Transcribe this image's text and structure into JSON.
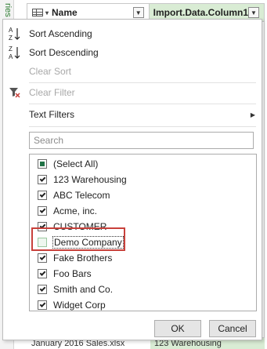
{
  "sidebar_label": "ries",
  "grid": {
    "col_name": "Name",
    "col_import": "Import.Data.Column1",
    "bottom_row": {
      "name": "January 2016 Sales.xlsx",
      "value": "123 Warehousing"
    }
  },
  "menu": {
    "sort_ascending": "Sort Ascending",
    "sort_descending": "Sort Descending",
    "clear_sort": "Clear Sort",
    "clear_filter": "Clear Filter",
    "text_filters": "Text Filters",
    "search_placeholder": "Search",
    "items": [
      {
        "label": "(Select All)",
        "state": "partial"
      },
      {
        "label": "123 Warehousing",
        "state": "checked"
      },
      {
        "label": "ABC Telecom",
        "state": "checked"
      },
      {
        "label": "Acme, inc.",
        "state": "checked"
      },
      {
        "label": "CUSTOMER",
        "state": "checked"
      },
      {
        "label": "Demo Company",
        "state": "unchecked"
      },
      {
        "label": "Fake Brothers",
        "state": "checked"
      },
      {
        "label": "Foo Bars",
        "state": "checked"
      },
      {
        "label": "Smith and Co.",
        "state": "checked"
      },
      {
        "label": "Widget Corp",
        "state": "checked"
      }
    ],
    "ok_label": "OK",
    "cancel_label": "Cancel"
  },
  "colors": {
    "accent_green": "#217346",
    "header_green": "#d9ecd4",
    "highlight_red": "#c8413b"
  },
  "icons": [
    "table-icon",
    "filter-dropdown-icon",
    "sort-ascending-icon",
    "sort-descending-icon",
    "clear-filter-icon",
    "submenu-arrow-icon"
  ]
}
